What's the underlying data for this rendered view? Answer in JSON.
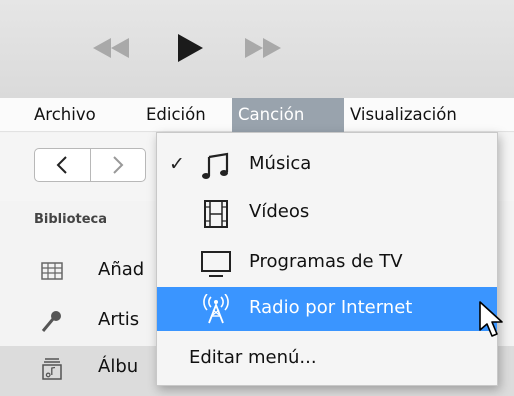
{
  "toolbar": {
    "prev_icon": "rewind-icon",
    "play_icon": "play-icon",
    "next_icon": "fast-forward-icon"
  },
  "menubar": {
    "items": [
      "Archivo",
      "Edición",
      "Canción",
      "Visualización"
    ],
    "active": "Canción"
  },
  "library": {
    "header": "Biblioteca",
    "items": [
      {
        "label": "Añadido recientemente",
        "visible_label": "Añad",
        "icon": "grid-icon"
      },
      {
        "label": "Artistas",
        "visible_label": "Artis",
        "icon": "microphone-icon"
      },
      {
        "label": "Álbumes",
        "visible_label": "Álbu",
        "icon": "album-icon",
        "selected": true
      }
    ]
  },
  "menu": {
    "items": [
      {
        "label": "Música",
        "icon": "music-note-icon",
        "checked": true
      },
      {
        "label": "Vídeos",
        "icon": "film-icon",
        "checked": false
      },
      {
        "label": "Programas de TV",
        "icon": "monitor-icon",
        "checked": false
      },
      {
        "label": "Radio por Internet",
        "icon": "radio-tower-icon",
        "checked": false,
        "highlighted": true
      }
    ],
    "edit_label": "Editar menú...",
    "check_glyph": "✓"
  },
  "colors": {
    "highlight": "#3a95ff",
    "menubar_active": "#99a3ad"
  }
}
